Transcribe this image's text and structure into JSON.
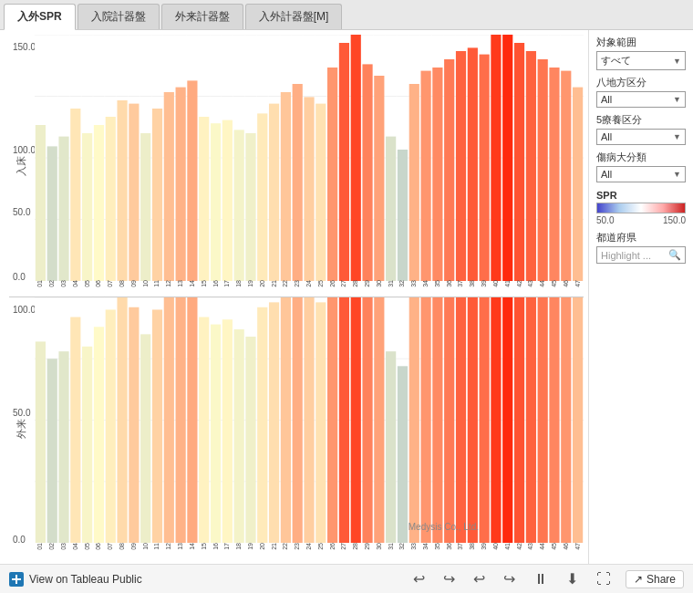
{
  "tabs": [
    {
      "id": "tab1",
      "label": "入外SPR",
      "active": true
    },
    {
      "id": "tab2",
      "label": "入院計器盤",
      "active": false
    },
    {
      "id": "tab3",
      "label": "外来計器盤",
      "active": false
    },
    {
      "id": "tab4",
      "label": "入外計器盤[M]",
      "active": false
    }
  ],
  "filters": {
    "target": {
      "label": "対象範囲",
      "value": "すべて"
    },
    "region8": {
      "label": "八地方区分",
      "value": "All"
    },
    "region5": {
      "label": "5療養区分",
      "value": "All"
    },
    "category": {
      "label": "傷病大分類",
      "value": "All"
    }
  },
  "spr": {
    "label": "SPR",
    "min": "50.0",
    "max": "150.0"
  },
  "highlight": {
    "label": "都道府県",
    "placeholder": "Highlight ..."
  },
  "charts": {
    "top": {
      "yLabel": "入床",
      "yMax": "150.0",
      "yMid": "100.0",
      "yLow": "50.0",
      "y0": "0.0"
    },
    "bottom": {
      "yLabel": "外来",
      "yMax": "100.0",
      "yMid": "50.0",
      "y0": "0.0"
    }
  },
  "toolbar": {
    "viewLabel": "View on Tableau Public",
    "shareLabel": "Share"
  },
  "credit": "Medysis Co., Ltd."
}
